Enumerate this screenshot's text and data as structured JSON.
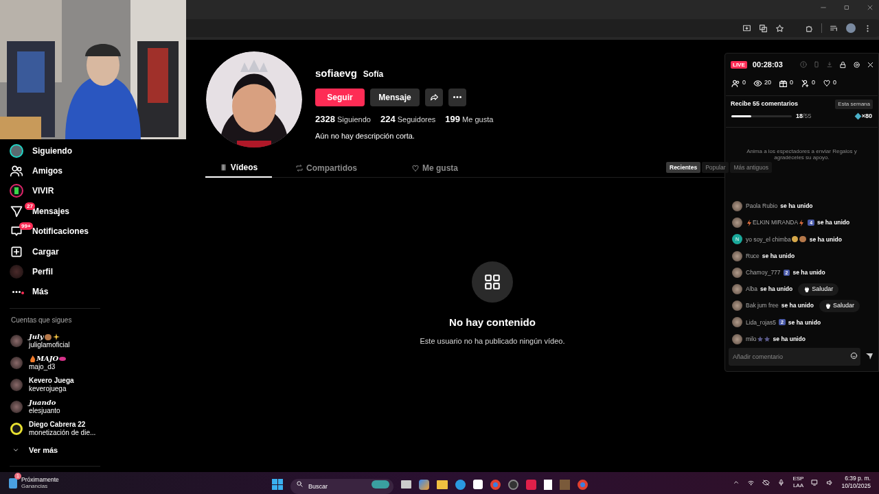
{
  "sidebar": {
    "items": [
      {
        "label": "Siguiendo",
        "kind": "avatar"
      },
      {
        "label": "Amigos",
        "kind": "friends"
      },
      {
        "label": "VIVIR",
        "kind": "live"
      },
      {
        "label": "Mensajes",
        "kind": "messages",
        "badge": "27"
      },
      {
        "label": "Notificaciones",
        "kind": "inbox",
        "badge": "99+"
      },
      {
        "label": "Cargar",
        "kind": "upload"
      },
      {
        "label": "Perfil",
        "kind": "avatar"
      },
      {
        "label": "Más",
        "kind": "more",
        "dot": true
      }
    ],
    "following_title": "Cuentas que sigues",
    "following": [
      {
        "name": "July",
        "script": true,
        "ringed": false,
        "after": [
          {
            "kind": "bear"
          },
          {
            "kind": "sparkle"
          }
        ],
        "handle": "juliglamoficial"
      },
      {
        "name": "MAJO",
        "script": true,
        "ringed": false,
        "before": [
          {
            "kind": "flame"
          }
        ],
        "after": [
          {
            "kind": "lips"
          }
        ],
        "handle": "majo_d3"
      },
      {
        "name": "Kevero Juega",
        "script": false,
        "ringed": false,
        "handle": "keverojuega"
      },
      {
        "name": "Juando",
        "script": true,
        "ringed": false,
        "handle": "elesjuanto"
      },
      {
        "name": "Diego Cabrera 22",
        "script": false,
        "handle": "monetización de die...",
        "ringed": true
      }
    ],
    "see_more": "Ver más"
  },
  "profile": {
    "username": "sofiaevg",
    "nickname": "Sofía",
    "buttons": [
      {
        "label": "Seguir",
        "kind": "primary"
      },
      {
        "label": "Mensaje",
        "kind": "secondary"
      }
    ],
    "stats": [
      "**2328** Siguiendo",
      "**224** Seguidores",
      "**199** Me gusta"
    ],
    "bio": "Aún no hay descripción corta.",
    "tabs": [
      {
        "label": "Vídeos",
        "kind": "grid",
        "selected": true
      },
      {
        "label": "Compartidos",
        "kind": "repost",
        "selected": false
      },
      {
        "label": "Me gusta",
        "kind": "heart",
        "selected": false
      }
    ],
    "sort": [
      {
        "label": "Recientes",
        "selected": true
      },
      {
        "label": "Popular",
        "selected": false
      },
      {
        "label": "Más antiguos",
        "selected": false
      }
    ],
    "empty_title": "No hay contenido",
    "empty_text": "Este usuario no ha publicado ningún vídeo."
  },
  "live_panel": {
    "badge": "LIVE",
    "timer": "00:28:03",
    "stats": [
      {
        "kind": "people",
        "value": "0"
      },
      {
        "kind": "eye",
        "value": "20"
      },
      {
        "kind": "gift",
        "value": "0"
      },
      {
        "kind": "person-plus",
        "value": "0"
      },
      {
        "kind": "heart",
        "value": "0"
      }
    ],
    "goal": {
      "title": "Recibe 55 comentarios",
      "period": "Esta semana",
      "level": 0.33,
      "done": "18",
      "total": "/55",
      "reward": "×80"
    },
    "prompt": "Anima a los espectadores a enviar Regalos y agradéceles su apoyo.",
    "comments": [
      {
        "user": "Paola Rubio",
        "text": "se ha unido"
      },
      {
        "user": "ELKIN MIRANDA",
        "before": [
          {
            "kind": "bolt"
          }
        ],
        "after": [
          {
            "kind": "bolt"
          }
        ],
        "level": "4",
        "text": "se ha unido"
      },
      {
        "user": "yo soy_el chimba",
        "avatar_letter": "N",
        "after": [
          {
            "kind": "smile"
          },
          {
            "kind": "bear"
          }
        ],
        "text": "se ha unido"
      },
      {
        "user": "Ruce",
        "text": "se ha unido"
      },
      {
        "user": "Chamoy_777",
        "level": "2",
        "text": "se ha unido"
      },
      {
        "user": "Alba",
        "text": "se ha unido",
        "button": "Saludar"
      },
      {
        "user": "Bak jum free",
        "text": "se ha unido",
        "button": "Saludar"
      },
      {
        "user": "Lida_rojas5",
        "level": "2",
        "text": "se ha unido"
      },
      {
        "user": "milo",
        "after": [
          {
            "kind": "star"
          },
          {
            "kind": "star"
          }
        ],
        "text": "se ha unido"
      }
    ],
    "input_placeholder": "Añadir comentario"
  },
  "taskbar": {
    "widget_title": "Próximamente",
    "widget_subtitle": "Ganancias",
    "widget_badge": "1",
    "search_placeholder": "Buscar",
    "lang": "ESP",
    "layout": "LAA",
    "time": "6:39 p. m.",
    "date": "10/10/2025"
  }
}
